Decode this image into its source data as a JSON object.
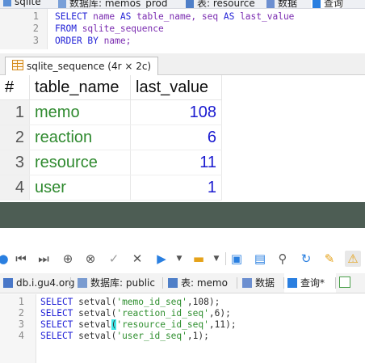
{
  "top_window": {
    "tabs": [
      "sqlite",
      "数据库: memos_prod",
      "表: resource",
      "数据",
      "查询"
    ],
    "editor": {
      "line_numbers": [
        "1",
        "2",
        "3"
      ],
      "lines": [
        {
          "kw1": "SELECT",
          "t1": " name ",
          "kw2": "AS",
          "t2": " table_name, seq ",
          "kw3": "AS",
          "t3": " last_value"
        },
        {
          "kw1": "FROM",
          "t1": " sqlite_sequence"
        },
        {
          "kw1": "ORDER BY",
          "t1": " name;"
        }
      ]
    },
    "result_tab": "sqlite_sequence (4r × 2c)",
    "table": {
      "columns": [
        "#",
        "table_name",
        "last_value"
      ],
      "rows": [
        {
          "n": "1",
          "name": "memo",
          "value": "108"
        },
        {
          "n": "2",
          "name": "reaction",
          "value": "6"
        },
        {
          "n": "3",
          "name": "resource",
          "value": "11"
        },
        {
          "n": "4",
          "name": "user",
          "value": "1"
        }
      ]
    }
  },
  "bottom_window": {
    "tabs": [
      "db.i.gu4.org",
      "数据库: public",
      "表: memo",
      "数据",
      "查询*"
    ],
    "editor": {
      "line_numbers": [
        "1",
        "2",
        "3",
        "4"
      ],
      "lines": [
        {
          "kw": "SELECT",
          "fn": " setval",
          "open": "(",
          "arg": "'memo_id_seq'",
          "comma": ",",
          "num": "108",
          "close": ");"
        },
        {
          "kw": "SELECT",
          "fn": " setval",
          "open": "(",
          "arg": "'reaction_id_seq'",
          "comma": ",",
          "num": "6",
          "close": ");"
        },
        {
          "kw": "SELECT",
          "fn": " setval",
          "open": "(",
          "arg": "'resource_id_seq'",
          "comma": ",",
          "num": "11",
          "close": ");"
        },
        {
          "kw": "SELECT",
          "fn": " setval",
          "open": "(",
          "arg": "'user_id_seq'",
          "comma": ",",
          "num": "1",
          "close": ");"
        }
      ]
    }
  },
  "icons": [
    "stop-icon",
    "first-page-icon",
    "last-page-icon",
    "add-row-icon",
    "delete-row-icon",
    "apply-icon",
    "cancel-icon",
    "run-icon",
    "dropdown-icon",
    "open-folder-icon",
    "save-icon",
    "export-icon",
    "search-icon",
    "refresh-icon",
    "clean-icon",
    "warning-icon"
  ],
  "colors": {
    "keyword": "#1f1fd6",
    "identifier": "#7a2bb0",
    "string": "#2f8f2f",
    "grid_text": "#2f8a2f",
    "grid_number": "#1a1ad0",
    "divider": "#4d5d54",
    "bracket_highlight": "#3fe8e8"
  }
}
